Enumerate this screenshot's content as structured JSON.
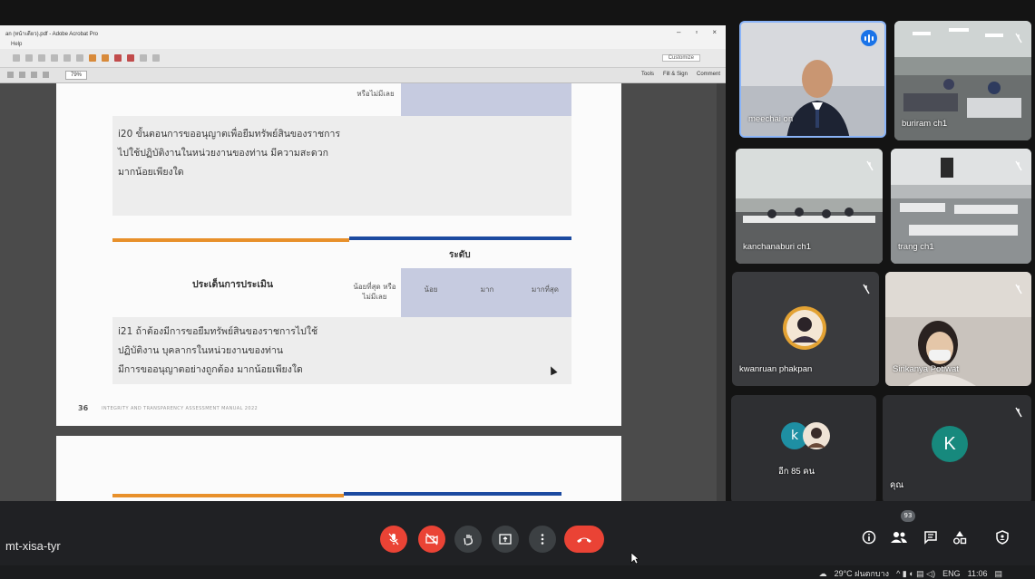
{
  "acrobat": {
    "title": "an (หน้าเดียว).pdf - Adobe Acrobat Pro",
    "menu": "Help",
    "customize": "Customize",
    "zoom": "79%",
    "links": [
      "Tools",
      "Fill & Sign",
      "Comment"
    ]
  },
  "document": {
    "top_fragment": "หรือไม่มีเลย",
    "q20": [
      "i20 ขั้นตอนการขออนุญาตเพื่อยืมทรัพย์สินของราชการ",
      "ไปใช้ปฏิบัติงานในหน่วยงานของท่าน มีความสะดวก",
      "มากน้อยเพียงใด"
    ],
    "level_heading": "ระดับ",
    "issue_heading": "ประเด็นการประเมิน",
    "columns": [
      "น้อยที่สุด หรือไม่มีเลย",
      "น้อย",
      "มาก",
      "มากที่สุด"
    ],
    "q21": [
      "i21 ถ้าต้องมีการขอยืมทรัพย์สินของราชการไปใช้",
      "ปฏิบัติงาน บุคลากรในหน่วยงานของท่าน",
      "มีการขออนุญาตอย่างถูกต้อง มากน้อยเพียงใด"
    ],
    "page_number": "36",
    "footer": "INTEGRITY AND TRANSPARENCY ASSESSMENT MANUAL 2022"
  },
  "participants": [
    {
      "name": "meechai on"
    },
    {
      "name": "buriram ch1"
    },
    {
      "name": "kanchanaburi ch1"
    },
    {
      "name": "trang ch1"
    },
    {
      "name": "kwanruan phakpan"
    },
    {
      "name": "Sirikanya Potiwat"
    },
    {
      "name": "อีก 85 คน",
      "initial": "k"
    },
    {
      "name": "คุณ",
      "initial": "K"
    }
  ],
  "meeting": {
    "code": "mt-xisa-tyr",
    "participant_count": "93"
  },
  "taskbar": {
    "weather": "29°C ฝนตกบาง",
    "lang": "ENG",
    "time": "11:06"
  },
  "colors": {
    "end_call": "#ea4335",
    "accent_blue": "#1a73e8",
    "rule_orange": "#e8902a",
    "rule_blue": "#1c4aa0",
    "avatar_teal": "#17897d",
    "avatar_blue": "#1e8fa3"
  }
}
